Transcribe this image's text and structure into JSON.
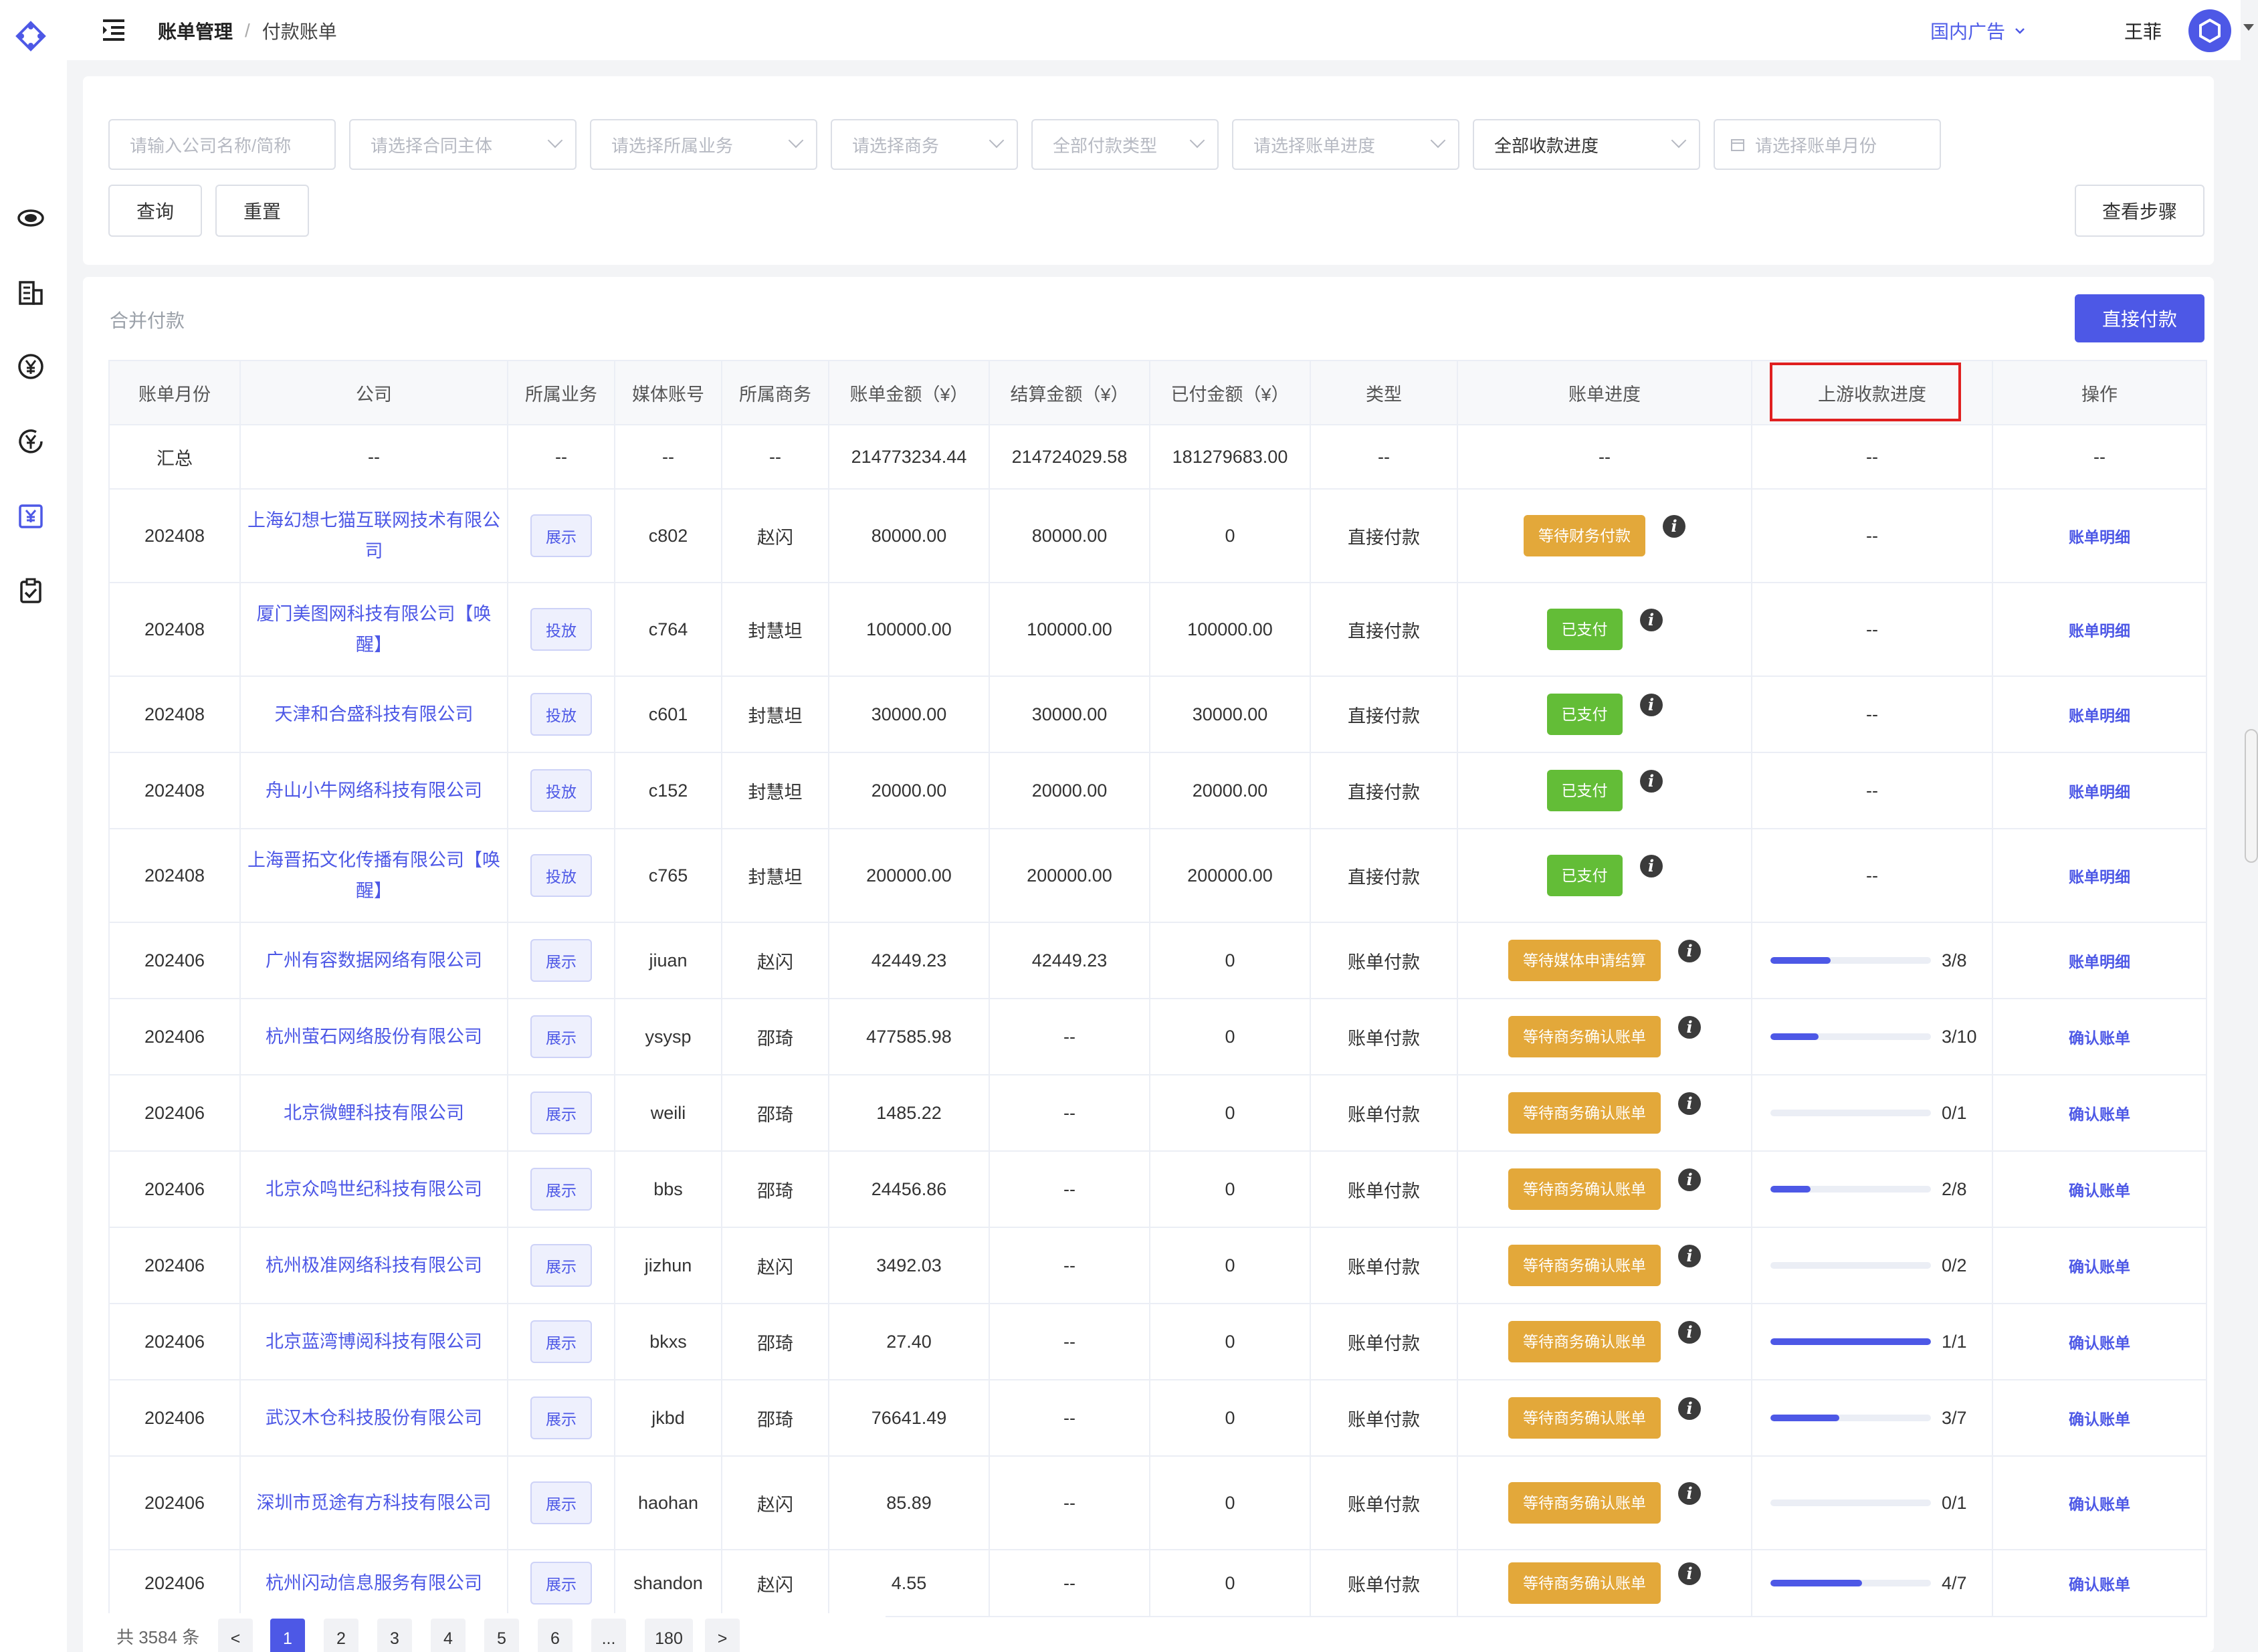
{
  "header": {
    "breadcrumb": [
      "账单管理",
      "付款账单"
    ],
    "breadcrumb_sep": "/",
    "region": "国内广告",
    "username": "王菲"
  },
  "sidebar": {
    "icons": [
      "coin-stack-icon",
      "building-icon",
      "yen-circle-icon",
      "yen-refresh-icon",
      "yen-ledger-icon",
      "clipboard-check-icon"
    ]
  },
  "filters": {
    "company_placeholder": "请输入公司名称/简称",
    "contract_placeholder": "请选择合同主体",
    "business_placeholder": "请选择所属业务",
    "merchant_placeholder": "请选择商务",
    "pay_type": "全部付款类型",
    "bill_progress_placeholder": "请选择账单进度",
    "receive_progress": "全部收款进度",
    "month_placeholder": "请选择账单月份",
    "query_label": "查询",
    "reset_label": "重置",
    "steps_label": "查看步骤"
  },
  "toolbar": {
    "merge_pay": "合并付款",
    "direct_pay": "直接付款"
  },
  "table": {
    "columns": [
      "账单月份",
      "公司",
      "所属业务",
      "媒体账号",
      "所属商务",
      "账单金额（¥）",
      "结算金额（¥）",
      "已付金额（¥）",
      "类型",
      "账单进度",
      "上游收款进度",
      "操作"
    ],
    "summary": [
      "汇总",
      "--",
      "--",
      "--",
      "--",
      "214773234.44",
      "214724029.58",
      "181279683.00",
      "--",
      "--",
      "--",
      "--"
    ],
    "rows": [
      {
        "month": "202408",
        "company": "上海幻想七猫互联网技术有限公司",
        "biz": "展示",
        "account": "c802",
        "merchant": "赵闪",
        "amount": "80000.00",
        "settle": "80000.00",
        "paid": "0",
        "type": "直接付款",
        "status": "等待财务付款",
        "status_color": "orange",
        "progress_text": "--",
        "progress": null,
        "op": "账单明细"
      },
      {
        "month": "202408",
        "company": "厦门美图网科技有限公司【唤醒】",
        "biz": "投放",
        "account": "c764",
        "merchant": "封慧坦",
        "amount": "100000.00",
        "settle": "100000.00",
        "paid": "100000.00",
        "type": "直接付款",
        "status": "已支付",
        "status_color": "green",
        "progress_text": "--",
        "progress": null,
        "op": "账单明细"
      },
      {
        "month": "202408",
        "company": "天津和合盛科技有限公司",
        "biz": "投放",
        "account": "c601",
        "merchant": "封慧坦",
        "amount": "30000.00",
        "settle": "30000.00",
        "paid": "30000.00",
        "type": "直接付款",
        "status": "已支付",
        "status_color": "green",
        "progress_text": "--",
        "progress": null,
        "op": "账单明细"
      },
      {
        "month": "202408",
        "company": "舟山小牛网络科技有限公司",
        "biz": "投放",
        "account": "c152",
        "merchant": "封慧坦",
        "amount": "20000.00",
        "settle": "20000.00",
        "paid": "20000.00",
        "type": "直接付款",
        "status": "已支付",
        "status_color": "green",
        "progress_text": "--",
        "progress": null,
        "op": "账单明细"
      },
      {
        "month": "202408",
        "company": "上海晋拓文化传播有限公司【唤醒】",
        "biz": "投放",
        "account": "c765",
        "merchant": "封慧坦",
        "amount": "200000.00",
        "settle": "200000.00",
        "paid": "200000.00",
        "type": "直接付款",
        "status": "已支付",
        "status_color": "green",
        "progress_text": "--",
        "progress": null,
        "op": "账单明细"
      },
      {
        "month": "202406",
        "company": "广州有容数据网络有限公司",
        "biz": "展示",
        "account": "jiuan",
        "merchant": "赵闪",
        "amount": "42449.23",
        "settle": "42449.23",
        "paid": "0",
        "type": "账单付款",
        "status": "等待媒体申请结算",
        "status_color": "orange",
        "progress_text": "3/8",
        "progress": 0.375,
        "op": "账单明细"
      },
      {
        "month": "202406",
        "company": "杭州萤石网络股份有限公司",
        "biz": "展示",
        "account": "ysysp",
        "merchant": "邵琦",
        "amount": "477585.98",
        "settle": "--",
        "paid": "0",
        "type": "账单付款",
        "status": "等待商务确认账单",
        "status_color": "orange",
        "progress_text": "3/10",
        "progress": 0.3,
        "op": "确认账单"
      },
      {
        "month": "202406",
        "company": "北京微鲤科技有限公司",
        "biz": "展示",
        "account": "weili",
        "merchant": "邵琦",
        "amount": "1485.22",
        "settle": "--",
        "paid": "0",
        "type": "账单付款",
        "status": "等待商务确认账单",
        "status_color": "orange",
        "progress_text": "0/1",
        "progress": 0,
        "op": "确认账单"
      },
      {
        "month": "202406",
        "company": "北京众鸣世纪科技有限公司",
        "biz": "展示",
        "account": "bbs",
        "merchant": "邵琦",
        "amount": "24456.86",
        "settle": "--",
        "paid": "0",
        "type": "账单付款",
        "status": "等待商务确认账单",
        "status_color": "orange",
        "progress_text": "2/8",
        "progress": 0.25,
        "op": "确认账单"
      },
      {
        "month": "202406",
        "company": "杭州极准网络科技有限公司",
        "biz": "展示",
        "account": "jizhun",
        "merchant": "赵闪",
        "amount": "3492.03",
        "settle": "--",
        "paid": "0",
        "type": "账单付款",
        "status": "等待商务确认账单",
        "status_color": "orange",
        "progress_text": "0/2",
        "progress": 0,
        "op": "确认账单"
      },
      {
        "month": "202406",
        "company": "北京蓝湾博阅科技有限公司",
        "biz": "展示",
        "account": "bkxs",
        "merchant": "邵琦",
        "amount": "27.40",
        "settle": "--",
        "paid": "0",
        "type": "账单付款",
        "status": "等待商务确认账单",
        "status_color": "orange",
        "progress_text": "1/1",
        "progress": 1,
        "op": "确认账单"
      },
      {
        "month": "202406",
        "company": "武汉木仓科技股份有限公司",
        "biz": "展示",
        "account": "jkbd",
        "merchant": "邵琦",
        "amount": "76641.49",
        "settle": "--",
        "paid": "0",
        "type": "账单付款",
        "status": "等待商务确认账单",
        "status_color": "orange",
        "progress_text": "3/7",
        "progress": 0.43,
        "op": "确认账单"
      },
      {
        "month": "202406",
        "company": "深圳市觅途有方科技有限公司",
        "biz": "展示",
        "account": "haohan",
        "merchant": "赵闪",
        "amount": "85.89",
        "settle": "--",
        "paid": "0",
        "type": "账单付款",
        "status": "等待商务确认账单",
        "status_color": "orange",
        "progress_text": "0/1",
        "progress": 0,
        "op": "确认账单"
      },
      {
        "month": "202406",
        "company": "杭州闪动信息服务有限公司",
        "biz": "展示",
        "account": "shandon",
        "merchant": "赵闪",
        "amount": "4.55",
        "settle": "--",
        "paid": "0",
        "type": "账单付款",
        "status": "等待商务确认账单",
        "status_color": "orange",
        "progress_text": "4/7",
        "progress": 0.57,
        "op": "确认账单"
      }
    ]
  },
  "pagination": {
    "total": "共 3584 条",
    "pages": [
      "1",
      "2",
      "3",
      "4",
      "5",
      "6",
      "...",
      "180"
    ],
    "current": "1",
    "prev": "<",
    "next": ">"
  },
  "colors": {
    "accent": "#4d58e6",
    "orange": "#e3a83a",
    "green": "#63bd37",
    "highlight": "#e02020"
  }
}
